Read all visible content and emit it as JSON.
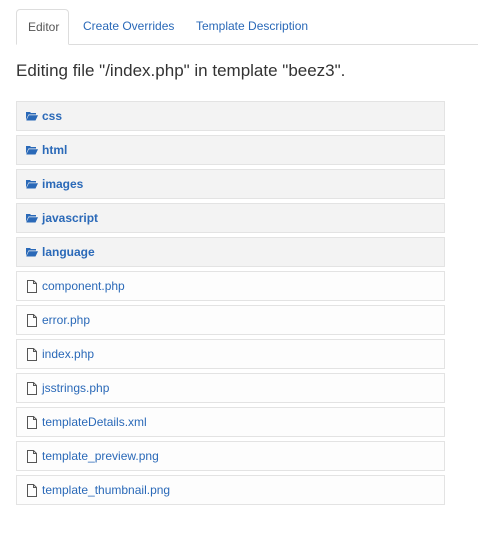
{
  "tabs": [
    {
      "label": "Editor",
      "active": true
    },
    {
      "label": "Create Overrides",
      "active": false
    },
    {
      "label": "Template Description",
      "active": false
    }
  ],
  "heading": "Editing file \"/index.php\" in template \"beez3\".",
  "folders": [
    {
      "label": "css",
      "icon": "folder-open-icon"
    },
    {
      "label": "html",
      "icon": "folder-open-icon"
    },
    {
      "label": "images",
      "icon": "folder-open-icon"
    },
    {
      "label": "javascript",
      "icon": "folder-open-icon"
    },
    {
      "label": "language",
      "icon": "folder-open-icon"
    }
  ],
  "files": [
    {
      "label": "component.php",
      "icon": "file-icon"
    },
    {
      "label": "error.php",
      "icon": "file-icon"
    },
    {
      "label": "index.php",
      "icon": "file-icon"
    },
    {
      "label": "jsstrings.php",
      "icon": "file-icon"
    },
    {
      "label": "templateDetails.xml",
      "icon": "file-icon"
    },
    {
      "label": "template_preview.png",
      "icon": "file-icon"
    },
    {
      "label": "template_thumbnail.png",
      "icon": "file-icon"
    }
  ],
  "colors": {
    "link": "#2a69b8",
    "folder_bg": "#f3f3f3",
    "border": "#e3e3e3"
  }
}
